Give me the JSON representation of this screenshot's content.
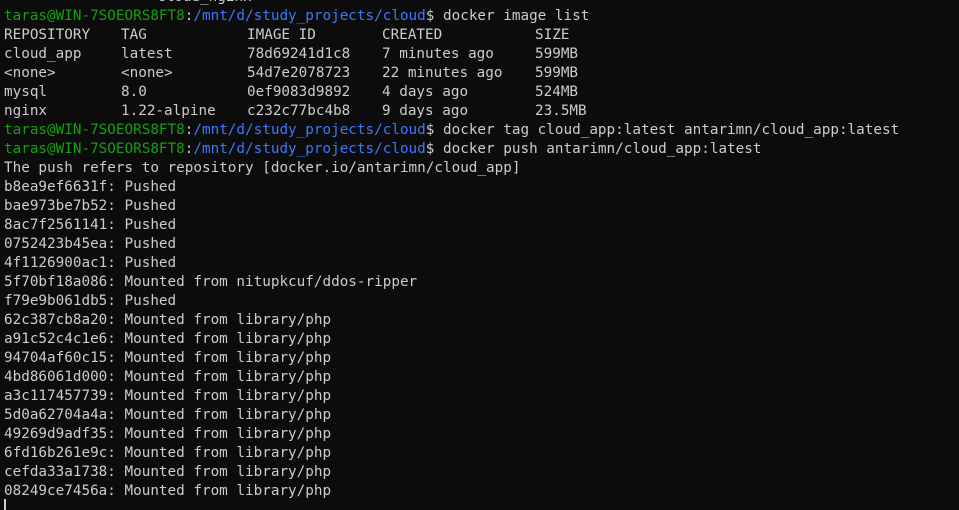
{
  "top_partial": "cloud_nginx",
  "prompt": {
    "user_host": "taras@WIN-7SOEORS8FT8",
    "sep": ":",
    "path": "/mnt/d/study_projects/cloud",
    "symbol": "$"
  },
  "commands": {
    "list": "docker image list",
    "tag": "docker tag cloud_app:latest antarimn/cloud_app:latest",
    "push": "docker push antarimn/cloud_app:latest"
  },
  "image_table": {
    "headers": [
      "REPOSITORY",
      "TAG",
      "IMAGE ID",
      "CREATED",
      "SIZE"
    ],
    "rows": [
      [
        "cloud_app",
        "latest",
        "78d69241d1c8",
        "7 minutes ago",
        "599MB"
      ],
      [
        "<none>",
        "<none>",
        "54d7e2078723",
        "22 minutes ago",
        "599MB"
      ],
      [
        "mysql",
        "8.0",
        "0ef9083d9892",
        "4 days ago",
        "524MB"
      ],
      [
        "nginx",
        "1.22-alpine",
        "c232c77bc4b8",
        "9 days ago",
        "23.5MB"
      ]
    ]
  },
  "push_header": "The push refers to repository [docker.io/antarimn/cloud_app]",
  "push_layers": [
    "b8ea9ef6631f: Pushed",
    "bae973be7b52: Pushed",
    "8ac7f2561141: Pushed",
    "0752423b45ea: Pushed",
    "4f1126900ac1: Pushed",
    "5f70bf18a086: Mounted from nitupkcuf/ddos-ripper",
    "f79e9b061db5: Pushed",
    "62c387cb8a20: Mounted from library/php",
    "a91c52c4c1e6: Mounted from library/php",
    "94704af60c15: Mounted from library/php",
    "4bd86061d000: Mounted from library/php",
    "a3c117457739: Mounted from library/php",
    "5d0a62704a4a: Mounted from library/php",
    "49269d9adf35: Mounted from library/php",
    "6fd16b261e9c: Mounted from library/php",
    "cefda33a1738: Mounted from library/php",
    "08249ce7456a: Mounted from library/php"
  ],
  "colors": {
    "background": "#0c0c0c",
    "text": "#cccccc",
    "user_host": "#13a10e",
    "path": "#3b78ff"
  }
}
